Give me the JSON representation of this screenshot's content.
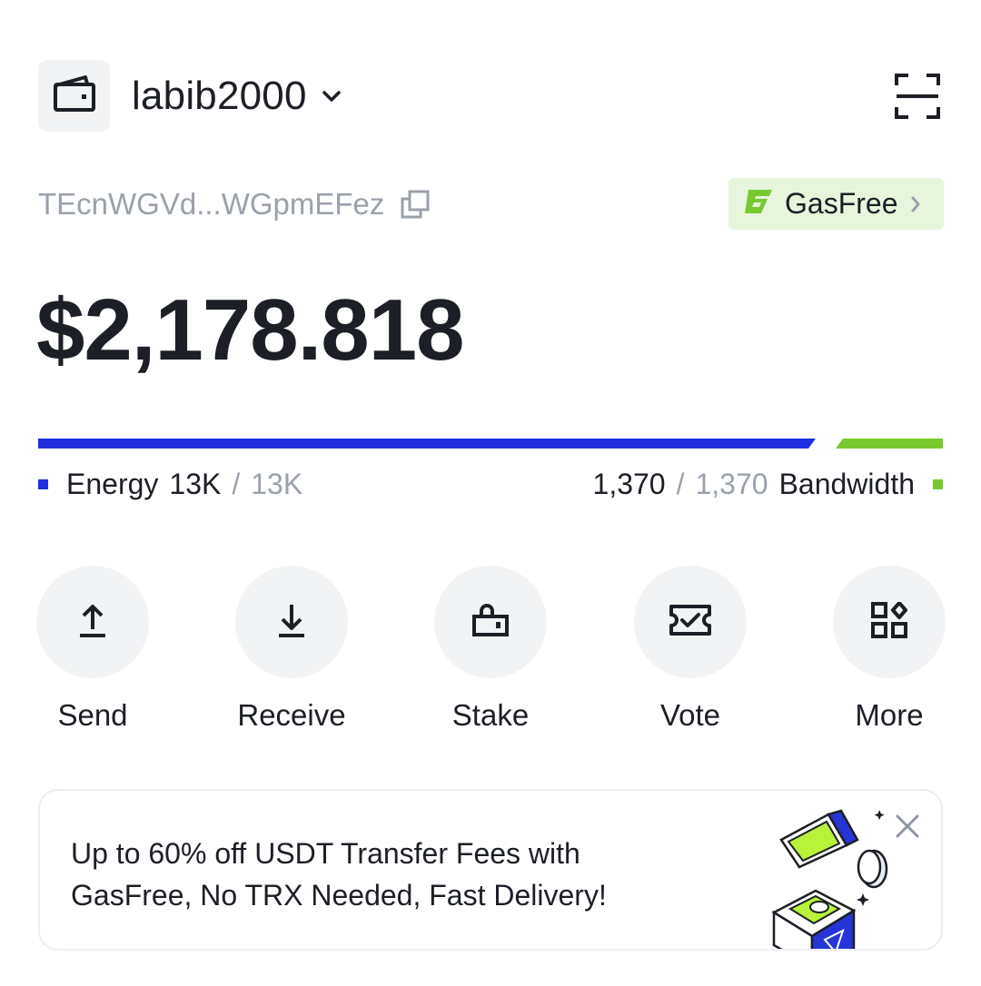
{
  "header": {
    "account_name": "labib2000",
    "icons": {
      "wallet": "wallet-icon",
      "dropdown": "chevron-down-icon",
      "scan": "scan-icon"
    }
  },
  "address": {
    "short": "TEcnWGVd...WGpmEFez",
    "copy_icon": "copy-icon"
  },
  "gasfree": {
    "label": "GasFree",
    "logo_icon": "gasfree-logo-icon",
    "chevron_icon": "chevron-right-icon",
    "accent": "#78c92f",
    "background": "#e6f5dc"
  },
  "balance": "$2,178.818",
  "resources": {
    "energy": {
      "label": "Energy",
      "available": "13K",
      "separator": "/",
      "total": "13K",
      "color": "#1f2fe0",
      "fraction": 1.0
    },
    "bandwidth": {
      "label": "Bandwidth",
      "available": "1,370",
      "separator": "/",
      "total": "1,370",
      "color": "#78c92f",
      "fraction": 1.0
    }
  },
  "actions": [
    {
      "label": "Send",
      "icon": "upload-arrow-icon"
    },
    {
      "label": "Receive",
      "icon": "download-arrow-icon"
    },
    {
      "label": "Stake",
      "icon": "lock-icon"
    },
    {
      "label": "Vote",
      "icon": "ticket-check-icon"
    },
    {
      "label": "More",
      "icon": "grid-apps-icon"
    }
  ],
  "banner": {
    "text": "Up to 60% off USDT Transfer Fees with GasFree, No TRX Needed, Fast Delivery!",
    "close_icon": "close-icon"
  }
}
